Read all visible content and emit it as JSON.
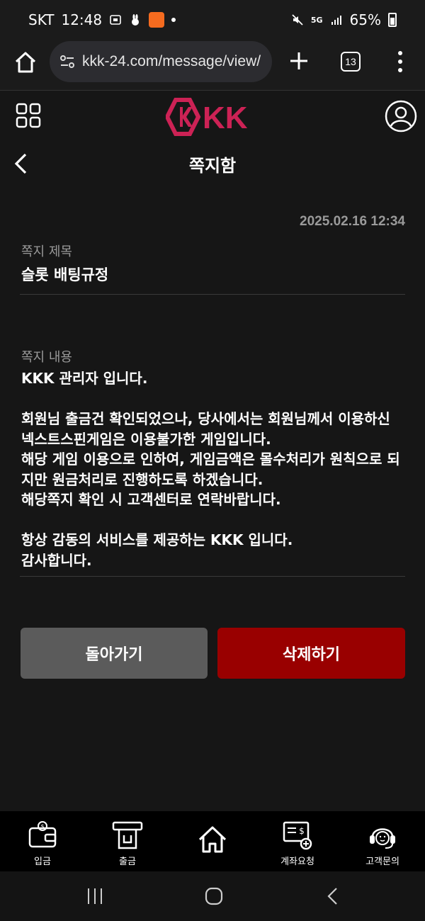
{
  "status": {
    "carrier": "SKT",
    "time": "12:48",
    "battery": "65%",
    "network": "5G"
  },
  "browser": {
    "url": "kkk-24.com/message/view/",
    "tab_count": "13"
  },
  "site": {
    "logo_text": "KK"
  },
  "page": {
    "title": "쪽지함"
  },
  "message": {
    "date": "2025.02.16 12:34",
    "subject_label": "쪽지 제목",
    "subject": "슬롯 배팅규정",
    "content_label": "쪽지 내용",
    "content": "KKK 관리자 입니다.\n\n회원님 출금건 확인되었으나, 당사에서는 회원님께서 이용하신 넥스트스핀게임은 이용불가한 게임입니다.\n해당 게임 이용으로 인하여, 게임금액은 몰수처리가 원칙으로 되지만 원금처리로 진행하도록 하겠습니다.\n해당쪽지 확인 시 고객센터로 연락바랍니다.\n\n항상 감동의 서비스를 제공하는 KKK 입니다.\n감사합니다."
  },
  "buttons": {
    "back": "돌아가기",
    "delete": "삭제하기"
  },
  "bottom_nav": [
    {
      "label": "입금",
      "icon": "wallet-icon"
    },
    {
      "label": "출금",
      "icon": "withdraw-icon"
    },
    {
      "label": "",
      "icon": "home-icon"
    },
    {
      "label": "계좌요청",
      "icon": "account-request-icon"
    },
    {
      "label": "고객문의",
      "icon": "headset-icon"
    }
  ],
  "colors": {
    "accent": "#cc2255",
    "delete": "#990000",
    "back": "#5b5b5b",
    "background": "#161616"
  }
}
